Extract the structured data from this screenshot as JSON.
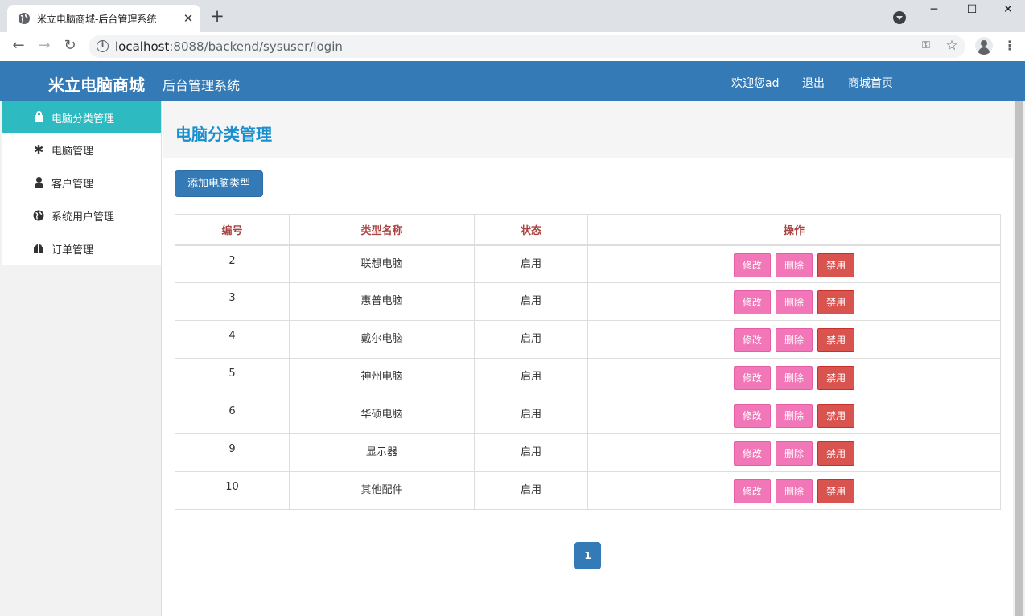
{
  "browser": {
    "tab_title": "米立电脑商城-后台管理系统",
    "url_host": "localhost",
    "url_rest": ":8088/backend/sysuser/login"
  },
  "header": {
    "brand": "米立电脑商城",
    "subtitle": "后台管理系统",
    "nav": [
      {
        "label": "欢迎您ad"
      },
      {
        "label": "退出"
      },
      {
        "label": "商城首页"
      }
    ]
  },
  "sidebar": {
    "items": [
      {
        "label": "电脑分类管理",
        "icon": "lock-icon",
        "active": true
      },
      {
        "label": "电脑管理",
        "icon": "asterisk-icon",
        "active": false
      },
      {
        "label": "客户管理",
        "icon": "user-icon",
        "active": false
      },
      {
        "label": "系统用户管理",
        "icon": "globe-icon",
        "active": false
      },
      {
        "label": "订单管理",
        "icon": "gift-icon",
        "active": false
      }
    ]
  },
  "main": {
    "title": "电脑分类管理",
    "add_button": "添加电脑类型",
    "table": {
      "headers": [
        "编号",
        "类型名称",
        "状态",
        "操作"
      ],
      "rows": [
        {
          "id": "2",
          "name": "联想电脑",
          "status": "启用"
        },
        {
          "id": "3",
          "name": "惠普电脑",
          "status": "启用"
        },
        {
          "id": "4",
          "name": "戴尔电脑",
          "status": "启用"
        },
        {
          "id": "5",
          "name": "神州电脑",
          "status": "启用"
        },
        {
          "id": "6",
          "name": "华硕电脑",
          "status": "启用"
        },
        {
          "id": "9",
          "name": "显示器",
          "status": "启用"
        },
        {
          "id": "10",
          "name": "其他配件",
          "status": "启用"
        }
      ],
      "actions": {
        "edit": "修改",
        "delete": "删除",
        "disable": "禁用"
      }
    },
    "pagination": {
      "current_page": "1"
    }
  },
  "colors": {
    "header_bg": "#337ab7",
    "sidebar_active": "#2dbac0",
    "title_blue": "#1a8fd0",
    "th_text": "#a94442",
    "btn_pink": "#f277b8",
    "btn_red": "#d9534f"
  }
}
